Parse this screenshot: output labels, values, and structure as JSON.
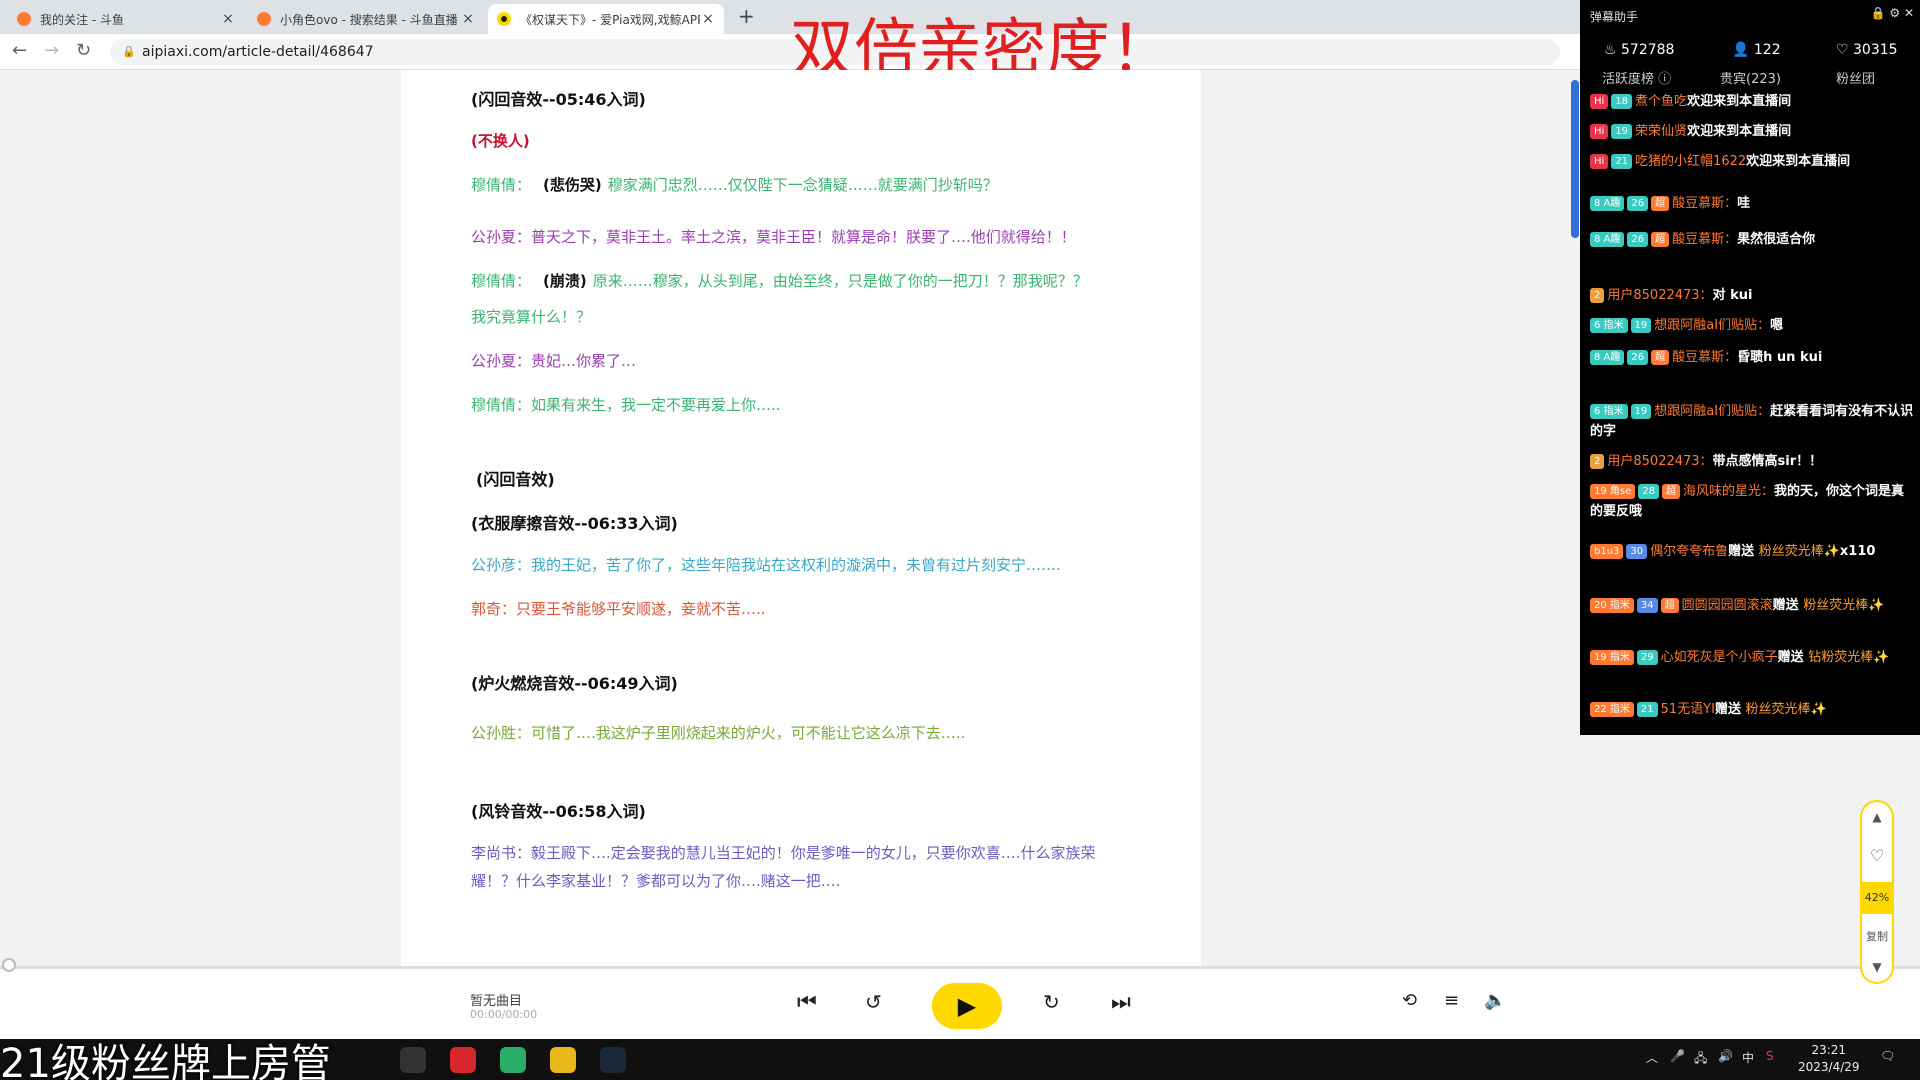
{
  "banner": "双倍亲密度！",
  "browser": {
    "tabs": [
      {
        "title": "我的关注 - 斗鱼"
      },
      {
        "title": "小角色ovo - 搜索结果 - 斗鱼直播"
      },
      {
        "title": "《权谋天下》- 爱Pia戏网,戏鲸APP"
      }
    ],
    "url": "aipiaxi.com/article-detail/468647"
  },
  "script_lines": [
    {
      "kind": "cue",
      "text": "(闪回音效--05:46入词)"
    },
    {
      "kind": "red",
      "text": "(不换人)"
    },
    {
      "kind": "line",
      "speaker": "穆倩倩：",
      "aside": "(悲伤哭)",
      "text": "穆家满门忠烈……仅仅陛下一念猜疑……就要满门抄斩吗？",
      "color": "g"
    },
    {
      "kind": "line",
      "speaker": "公孙夏：",
      "text": "普天之下，莫非王土。率土之滨，莫非王臣！就算是命！朕要了….他们就得给！！",
      "color": "p"
    },
    {
      "kind": "line",
      "speaker": "穆倩倩：",
      "aside": "(崩溃)",
      "text": "原来……穆家，从头到尾，由始至终，只是做了你的一把刀！？那我呢？？",
      "color": "g"
    },
    {
      "kind": "cont",
      "text": "我究竟算什么！？",
      "color": "g"
    },
    {
      "kind": "line",
      "speaker": "公孙夏：",
      "text": "贵妃…你累了…",
      "color": "p"
    },
    {
      "kind": "line",
      "speaker": "穆倩倩：",
      "text": "如果有来生，我一定不要再爱上你…..",
      "color": "g"
    },
    {
      "kind": "cue",
      "text": "(闪回音效)"
    },
    {
      "kind": "cue",
      "text": "(衣服摩擦音效--06:33入词)"
    },
    {
      "kind": "line",
      "speaker": "公孙彦：",
      "text": "我的王妃，苦了你了，这些年陪我站在这权利的漩涡中，未曾有过片刻安宁…….",
      "color": "b"
    },
    {
      "kind": "line",
      "speaker": "郭奇：",
      "text": "只要王爷能够平安顺遂，妾就不苦…..",
      "color": "o"
    },
    {
      "kind": "cue",
      "text": "(炉火燃烧音效--06:49入词)"
    },
    {
      "kind": "line",
      "speaker": "公孙胜：",
      "text": "可惜了….我这炉子里刚烧起来的炉火，可不能让它这么凉下去…..",
      "color": "l"
    },
    {
      "kind": "cue",
      "text": "(风铃音效--06:58入词)"
    },
    {
      "kind": "line",
      "speaker": "李尚书：",
      "text": "毅王殿下….定会娶我的慧儿当王妃的！你是爹唯一的女儿，只要你欢喜….什么家族荣",
      "color": "v"
    },
    {
      "kind": "cont",
      "text": "耀！？什么李家基业！？爹都可以为了你….赌这一把….",
      "color": "v"
    }
  ],
  "player": {
    "title": "暂无曲目",
    "time": "00:00/00:00"
  },
  "side_tool": {
    "pct": "42%",
    "copy": "复制"
  },
  "danmu": {
    "title": "弹幕助手",
    "stats": {
      "fire": "572788",
      "people": "122",
      "likes": "30315"
    },
    "tabs": [
      "活跃度榜",
      "贵宾(223)",
      "粉丝团"
    ],
    "messages": [
      {
        "badges": [
          {
            "t": "Hi",
            "c": "#e8344a"
          },
          {
            "t": "18",
            "c": "#3cc9c0"
          }
        ],
        "user": "煮个鱼吃",
        "text": "欢迎来到本直播间"
      },
      {
        "badges": [
          {
            "t": "Hi",
            "c": "#e8344a"
          },
          {
            "t": "19",
            "c": "#3cc9c0"
          }
        ],
        "user": "荣荣仙贤",
        "text": "欢迎来到本直播间"
      },
      {
        "badges": [
          {
            "t": "Hi",
            "c": "#e8344a"
          },
          {
            "t": "21",
            "c": "#3cc9c0"
          }
        ],
        "user": "吃猪的小红帽1622",
        "text": "欢迎来到本直播间"
      },
      {
        "badges": [
          {
            "t": "8 A趣",
            "c": "#3cc9c0"
          },
          {
            "t": "26",
            "c": "#3cc9c0"
          },
          {
            "t": "超",
            "c": "#ff7a33"
          }
        ],
        "user": "酸豆慕斯：",
        "text": "哇"
      },
      {
        "badges": [
          {
            "t": "8 A趣",
            "c": "#3cc9c0"
          },
          {
            "t": "26",
            "c": "#3cc9c0"
          },
          {
            "t": "超",
            "c": "#ff7a33"
          }
        ],
        "user": "酸豆慕斯：",
        "text": "果然很适合你"
      },
      {
        "badges": [
          {
            "t": "2",
            "c": "#e8a040"
          }
        ],
        "user": "用户85022473：",
        "text": "对 kui"
      },
      {
        "badges": [
          {
            "t": "6 指米",
            "c": "#3cc9c0"
          },
          {
            "t": "19",
            "c": "#3cc9c0"
          }
        ],
        "user": "想跟阿融aI们贴贴：",
        "text": "嗯"
      },
      {
        "badges": [
          {
            "t": "8 A趣",
            "c": "#3cc9c0"
          },
          {
            "t": "26",
            "c": "#3cc9c0"
          },
          {
            "t": "超",
            "c": "#ff7a33"
          }
        ],
        "user": "酸豆慕斯：",
        "text": "昏聩h un kui"
      },
      {
        "badges": [
          {
            "t": "6 指米",
            "c": "#3cc9c0"
          },
          {
            "t": "19",
            "c": "#3cc9c0"
          }
        ],
        "user": "想跟阿融aI们贴贴：",
        "text": "赶紧看看词有没有不认识的字"
      },
      {
        "badges": [
          {
            "t": "2",
            "c": "#e8a040"
          }
        ],
        "user": "用户85022473：",
        "text": "带点感情高sir！！"
      },
      {
        "badges": [
          {
            "t": "19 角se",
            "c": "#ff7a33"
          },
          {
            "t": "28",
            "c": "#3cc9c0"
          },
          {
            "t": "超",
            "c": "#ff7a33"
          }
        ],
        "user": "海风味的星光：",
        "text": "我的天，你这个词是真的要反哦"
      },
      {
        "badges": [
          {
            "t": "b1u3",
            "c": "#ff7a33"
          },
          {
            "t": "30",
            "c": "#5a8ae6"
          }
        ],
        "user": "偶尔夸夸布鲁",
        "text": "赠送 ",
        "gift": "粉丝荧光棒",
        "extra": "x110"
      },
      {
        "badges": [
          {
            "t": "20 指米",
            "c": "#ff7a33"
          },
          {
            "t": "34",
            "c": "#5a8ae6"
          },
          {
            "t": "超",
            "c": "#ff7a33"
          }
        ],
        "user": "圆圆园园圆滚滚",
        "text": "赠送 ",
        "gift": "粉丝荧光棒"
      },
      {
        "badges": [
          {
            "t": "19 指米",
            "c": "#ff7a33"
          },
          {
            "t": "29",
            "c": "#3cc9c0"
          }
        ],
        "user": "心如死灰是个小疯子",
        "text": "赠送 ",
        "gift": "钻粉荧光棒"
      },
      {
        "badges": [
          {
            "t": "22 指米",
            "c": "#ff7a33"
          },
          {
            "t": "21",
            "c": "#3cc9c0"
          }
        ],
        "user": "51无语YI",
        "text": "赠送 ",
        "gift": "粉丝荧光棒"
      }
    ]
  },
  "taskbar": {
    "overlay": "21级粉丝牌上房管",
    "tray_ime": "中",
    "time": "23:21",
    "date": "2023/4/29"
  },
  "colors": {
    "accent": "#ffd800",
    "banner": "#e0201e",
    "danmu_bg": "#000000"
  }
}
